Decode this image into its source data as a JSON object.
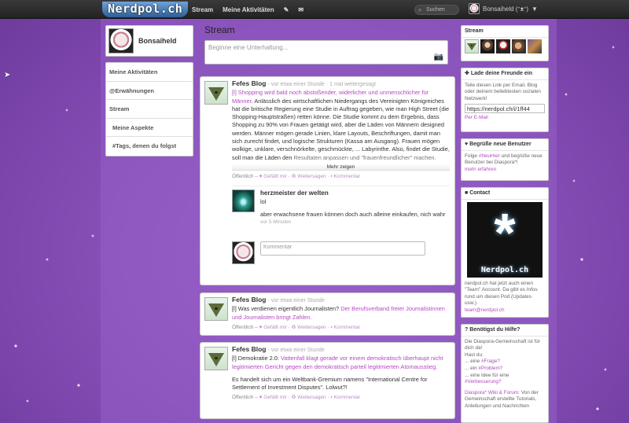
{
  "topbar": {
    "logo": "Nerdpol.ch",
    "nav": [
      "Stream",
      "Meine Aktivitäten"
    ],
    "search_placeholder": "Suchen",
    "user_name": "Bonsaiheld (ᵔᴥᵔ)"
  },
  "profile": {
    "name": "Bonsaiheld"
  },
  "leftnav": {
    "items": [
      "Meine Aktivitäten",
      "@Erwähnungen",
      "Stream",
      "Meine Aspekte",
      "#Tags, denen du folgst"
    ]
  },
  "stream": {
    "title": "Stream",
    "publisher_placeholder": "Beginne eine Unterhaltung..."
  },
  "posts": [
    {
      "author": "Fefes Blog",
      "meta": "- vor etwa einer Stunde · 1 mal weitergesagt",
      "link": "[l] Shopping wird bald noch abstoßender, widerlicher und unmenschlicher für Männer",
      "text": ". Anlässlich des wirtschaftlichen Niedergangs des Vereinigten Königreiches hat die britische Regierung eine Studie in Auftrag gegeben, wie man High Street (die Shopping-Hauptstraßen) retten könne. Die Studie kommt zu dem Ergebnis, dass Shopping zu 90% von Frauen getätigt wird, aber die Läden von Männern designed werden. Männer mögen gerade Linien, klare Layouts, Beschriftungen, damit man sich zurecht findet, und logische Strukturen (Kassa am Ausgang). Frauen mögen wolkige, unklare, verschnörkelte, geschmückte, ... Labyrinthe. Also, findet die Studie, soll man die Läden den",
      "fade": "Resultaten anpassen und \"frauenfreundlicher\" machen.",
      "more": "Mehr zeigen",
      "footer_prefix": "Öffentlich –",
      "like": "Gefällt mir",
      "reshare": "Weitersagen",
      "comment": "Kommentar"
    },
    {
      "author": "Fefes Blog",
      "meta": "- vor etwa einer Stunde",
      "link_prefix": "[l] Was verdienen eigentlich Journalisten?",
      "link": "Der Berufsverband freier Journalistinnen und Journalisten bringt Zahlen.",
      "footer_prefix": "Öffentlich –",
      "like": "Gefällt mir",
      "reshare": "Weitersagen",
      "comment": "Kommentar"
    },
    {
      "author": "Fefes Blog",
      "meta": "- vor etwa einer Stunde",
      "link_prefix": "[l] Demokratie 2.0:",
      "link": "Vattenfall klagt gerade vor einem demokratisch überhaupt nicht legitimierten Gericht gegen den demokratisch parteil legitimierten Atomausstieg.",
      "text2": "Es handelt sich um ein Weltbank-Gremium namens \"International Centre for Settlement of Investment Disputes\". Lolwut?!",
      "footer_prefix": "Öffentlich –",
      "like": "Gefällt mir",
      "reshare": "Weitersagen",
      "comment": "Kommentar"
    }
  ],
  "comment": {
    "author": "herzmeister der welten",
    "line1": "lol",
    "line2": "aber erwachsene frauen können doch auch alleine einkaufen, nich wahr",
    "time": "vor 5 Minuten",
    "new_placeholder": "Kommentar"
  },
  "right": {
    "stream_title": "Stream",
    "invite_title": "Lade deine Freunde ein",
    "invite_text": "Teile diesen Link per Email, Blog oder deinem beliebtesten sozialen Netzwerk!",
    "invite_link": "https://nerdpol.ch/i/1ff44",
    "invite_by": "Per E-Mail",
    "welcome_title": "Begrüße neue Benutzer",
    "welcome_text_1": "Folge",
    "welcome_tag": "#NeuHier",
    "welcome_text_2": "und begrüße neue Benutzer bei Diaspora*!",
    "welcome_more": "mehr erfahren",
    "contact_title": "Contact",
    "contact_logo_text": "Nerdpol.ch",
    "contact_text": "nerdpol.ch hat jetzt auch einen \"Team\" Account. Da gibt es Infos rund um diesen Pod (Updates usw.).",
    "contact_email": "team@nerdpol.ch",
    "help_title": "Benötigst du Hilfe?",
    "help_text": "Die Diaspora-Gemeinschaft ist für dich da!",
    "help_hast": "Hast du:",
    "help_1": "... eine",
    "help_1_tag": "#Frage?",
    "help_2": "... ein",
    "help_2_tag": "#Problem?",
    "help_3": "... eine Idee für eine",
    "help_3_tag": "#Verbesserung?",
    "help_wiki": "Diaspora* Wiki & Forum:",
    "help_wiki_text": "Von der Gemeinschaft erstellte Tutorials, Anleitungen und Nachrichten"
  },
  "icons": {
    "search": "search-icon",
    "camera": "camera-icon",
    "bell": "notification-icon"
  }
}
